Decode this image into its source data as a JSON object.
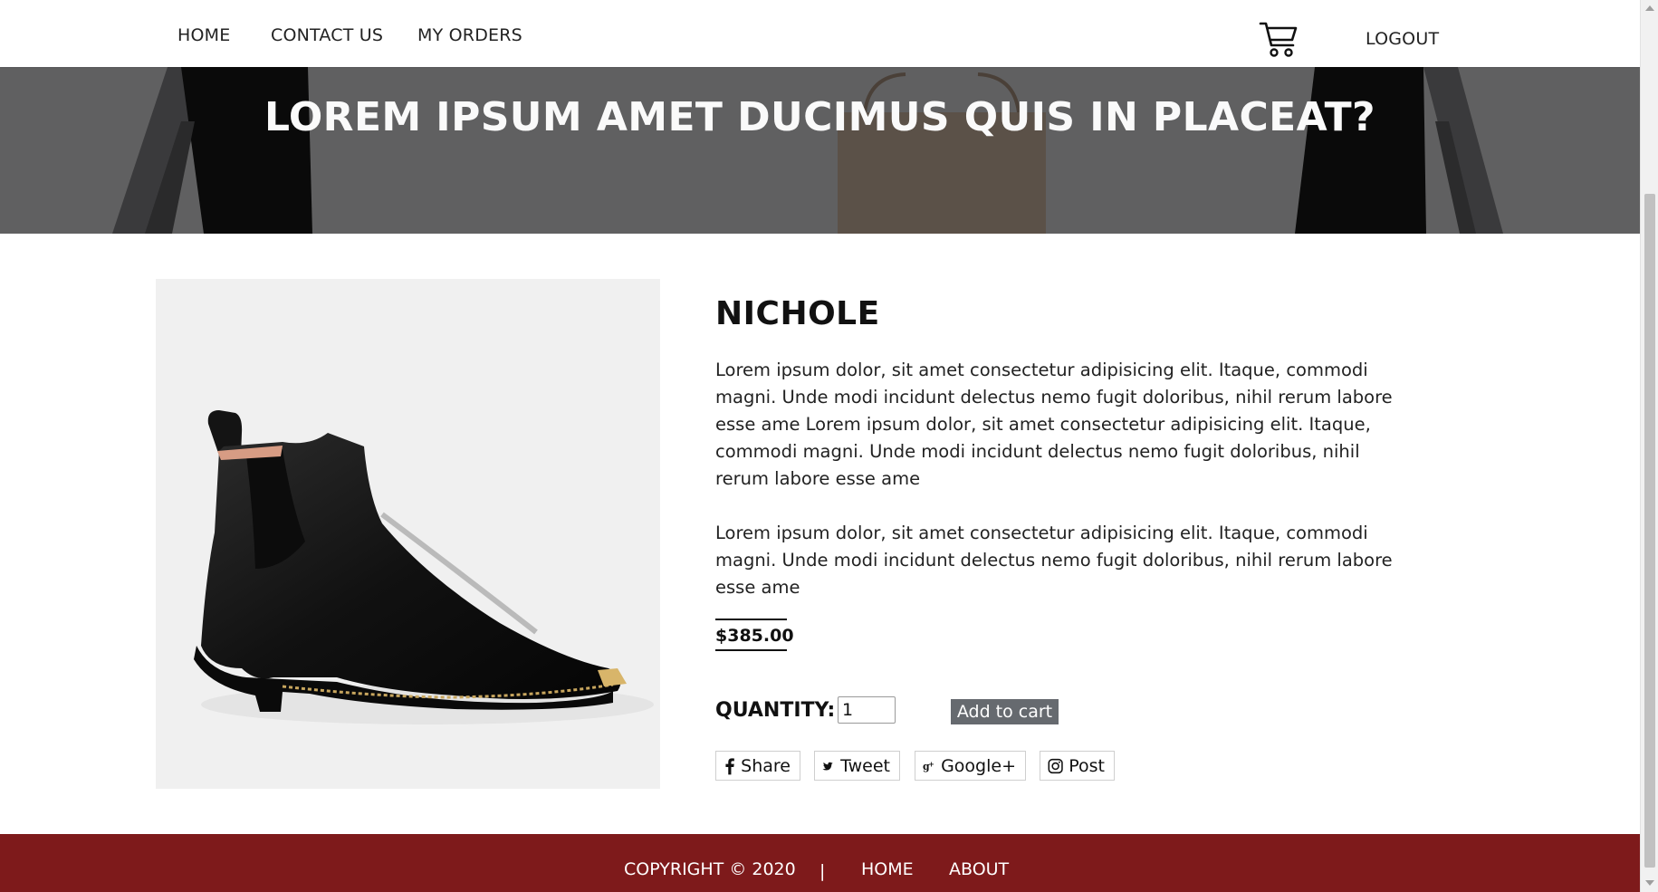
{
  "nav": {
    "home": "HOME",
    "contact": "CONTACT US",
    "orders": "MY ORDERS",
    "logout": "LOGOUT",
    "cart_icon": "shopping-cart-icon"
  },
  "hero": {
    "title": "LOREM IPSUM AMET DUCIMUS QUIS IN PLACEAT?"
  },
  "product": {
    "name": "NICHOLE",
    "description_1": "Lorem ipsum dolor, sit amet consectetur adipisicing elit. Itaque, commodi magni. Unde modi incidunt delectus nemo fugit doloribus, nihil rerum labore esse ame Lorem ipsum dolor, sit amet consectetur adipisicing elit. Itaque, commodi magni. Unde modi incidunt delectus nemo fugit doloribus, nihil rerum labore esse ame",
    "description_2": "Lorem ipsum dolor, sit amet consectetur adipisicing elit. Itaque, commodi magni. Unde modi incidunt delectus nemo fugit doloribus, nihil rerum labore esse ame",
    "price": "$385.00",
    "quantity_label": "QUANTITY:",
    "quantity_value": "1",
    "add_to_cart": "Add to cart"
  },
  "share": {
    "facebook": "Share",
    "twitter": "Tweet",
    "google": "Google+",
    "instagram": "Post"
  },
  "footer": {
    "copyright": "COPYRIGHT © 2020",
    "separator": "|",
    "home": "HOME",
    "about": "ABOUT"
  },
  "colors": {
    "footer_bg": "#7e1a1b",
    "hero_overlay": "#5f5f60",
    "button_bg": "#666a6f"
  }
}
